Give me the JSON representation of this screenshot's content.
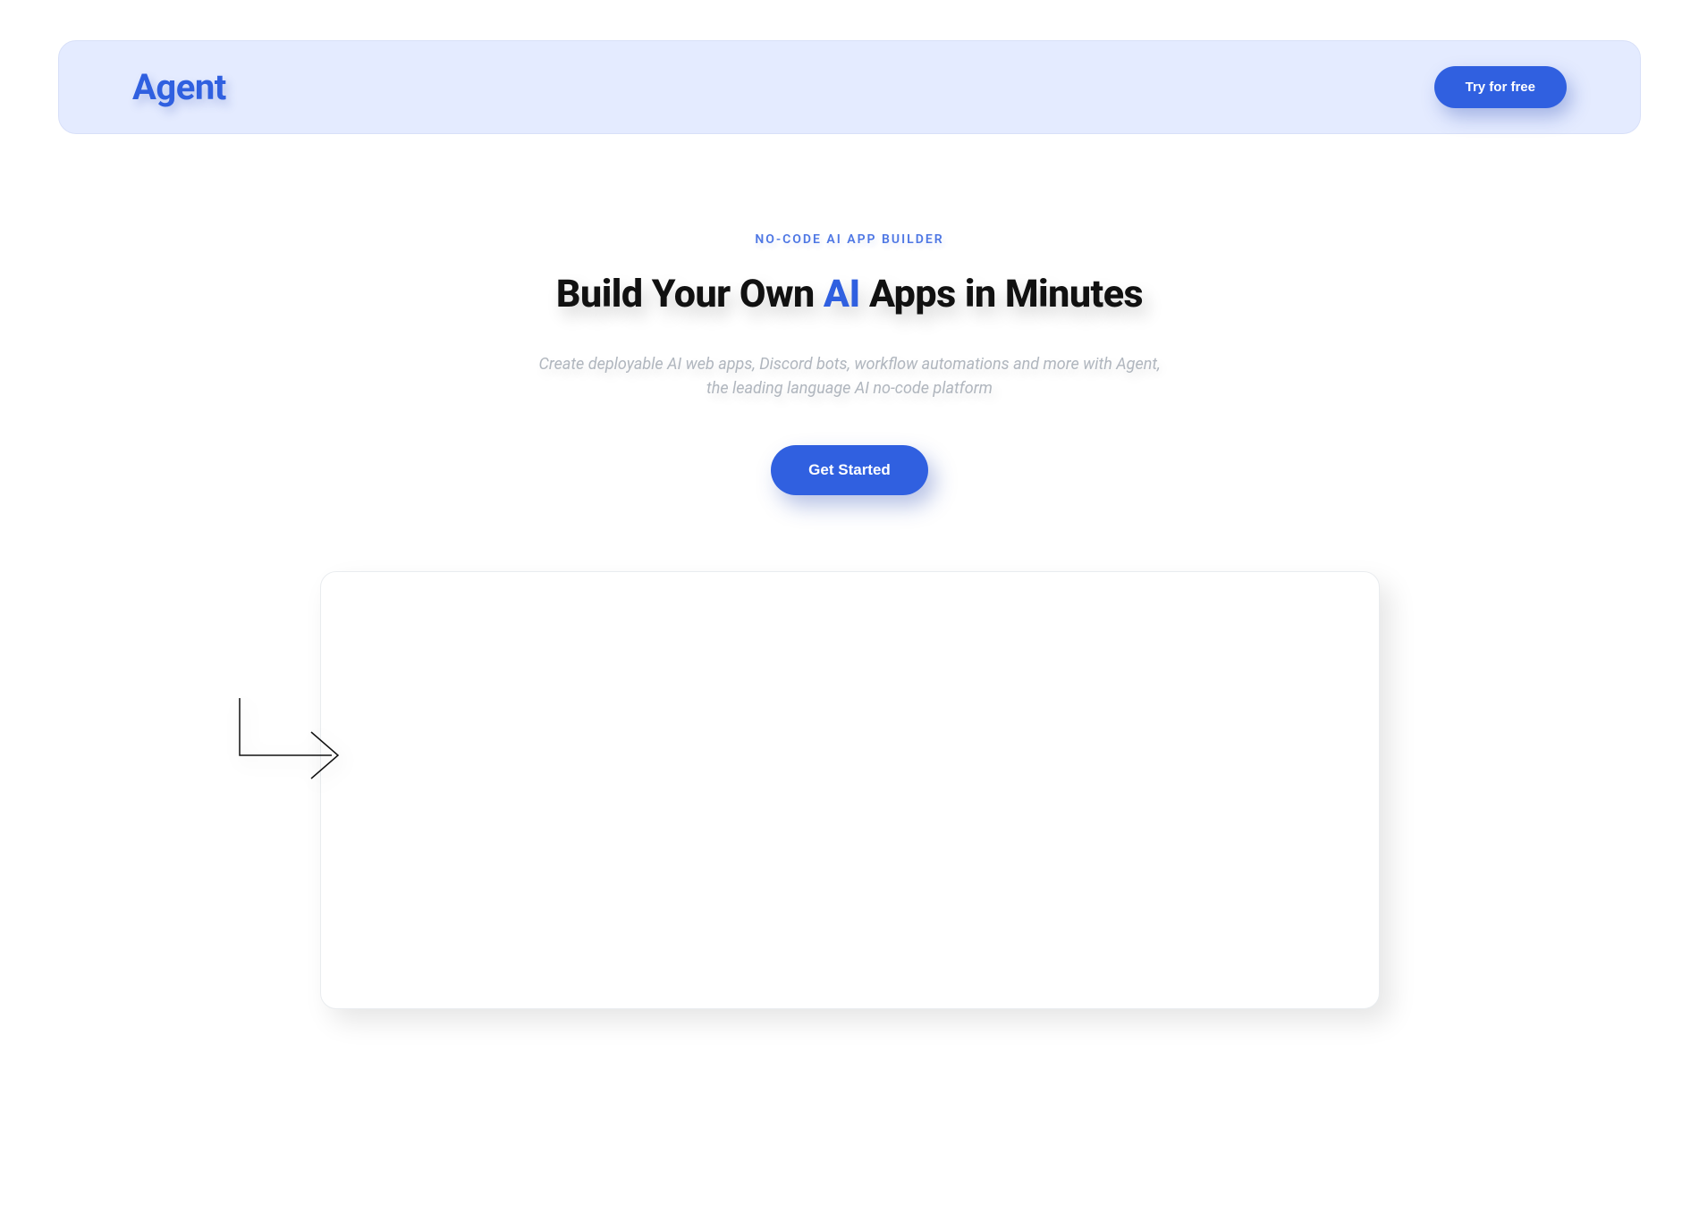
{
  "header": {
    "logo": "Agent",
    "cta_label": "Try for free"
  },
  "hero": {
    "eyebrow": "NO-CODE AI APP BUILDER",
    "headline_pre": "Build Your Own ",
    "headline_accent": "AI",
    "headline_post": " Apps in Minutes",
    "subhead": "Create deployable AI web apps, Discord bots, workflow automations and more with Agent, the leading language AI no-code platform",
    "cta_label": "Get Started"
  }
}
